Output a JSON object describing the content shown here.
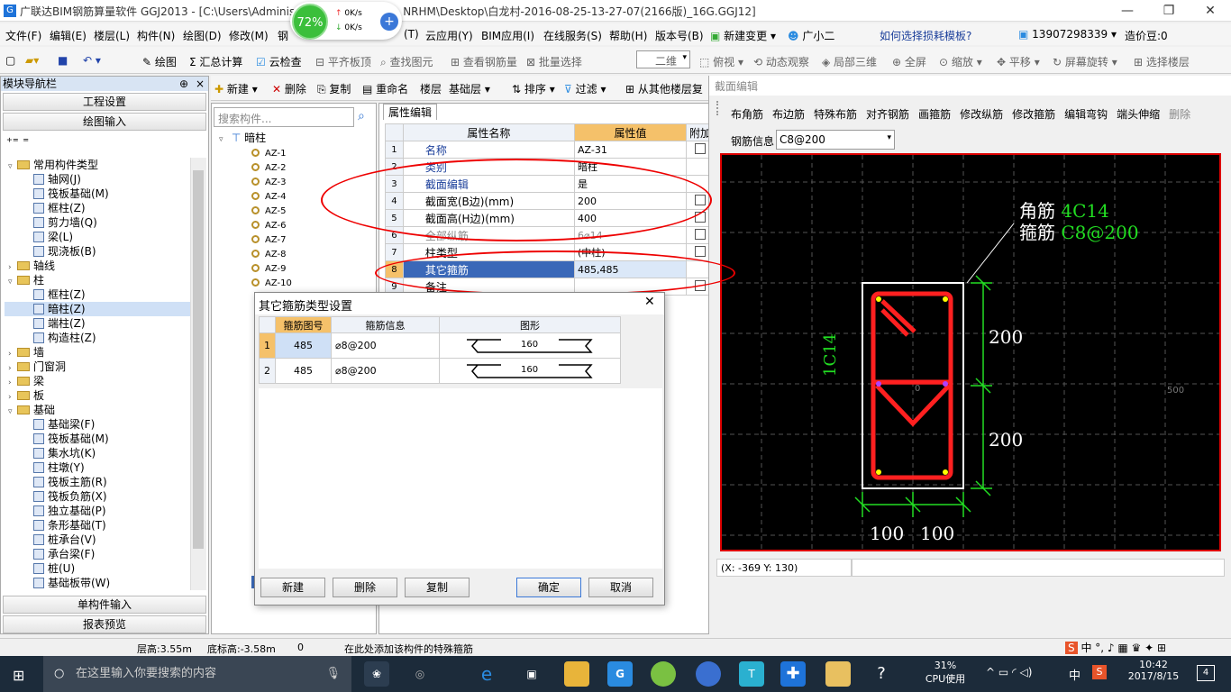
{
  "titlebar": {
    "title": "广联达BIM钢筋算量软件 GGJ2013 - [C:\\Users\\Adminis",
    "title_tail": "NRHM\\Desktop\\白龙村-2016-08-25-13-27-07(2166版)_16G.GGJ12]",
    "min": "—",
    "max": "❐",
    "close": "✕"
  },
  "speed": {
    "percent": "72%",
    "up": "0K/s",
    "down": "0K/s"
  },
  "menu": [
    "文件(F)",
    "编辑(E)",
    "楼层(L)",
    "构件(N)",
    "绘图(D)",
    "修改(M)",
    "钢",
    "(T)",
    "云应用(Y)",
    "BIM应用(I)",
    "在线服务(S)",
    "帮助(H)",
    "版本号(B)"
  ],
  "menu_right": {
    "change": "新建变更",
    "helper": "广小二",
    "tip": "如何选择损耗模板?",
    "phone": "13907298339",
    "coin": "造价豆:0"
  },
  "toolbar": {
    "draw": "绘图",
    "sum": "汇总计算",
    "cloud": "云检查",
    "flat": "平齐板顶",
    "find": "查找图元",
    "view_rebar": "查看钢筋量",
    "batch": "批量选择",
    "view2d": "二维",
    "top": "俯视",
    "dynamic": "动态观察",
    "local3d": "局部三维",
    "full": "全屏",
    "zoom": "缩放",
    "pan": "平移",
    "rotate": "屏幕旋转",
    "select_floor": "选择楼层"
  },
  "nav": {
    "header": "模块导航栏",
    "pin": "⊕",
    "close": "×",
    "proj": "工程设置",
    "draw_input": "绘图输入",
    "single": "单构件输入",
    "report": "报表预览",
    "tree": [
      {
        "t": "常用构件类型",
        "lvl": 0,
        "folder": true,
        "exp": "▿"
      },
      {
        "t": "轴网(J)",
        "lvl": 1
      },
      {
        "t": "筏板基础(M)",
        "lvl": 1
      },
      {
        "t": "框柱(Z)",
        "lvl": 1
      },
      {
        "t": "剪力墙(Q)",
        "lvl": 1
      },
      {
        "t": "梁(L)",
        "lvl": 1
      },
      {
        "t": "现浇板(B)",
        "lvl": 1
      },
      {
        "t": "轴线",
        "lvl": 0,
        "folder": true,
        "exp": "›"
      },
      {
        "t": "柱",
        "lvl": 0,
        "folder": true,
        "exp": "▿"
      },
      {
        "t": "框柱(Z)",
        "lvl": 1
      },
      {
        "t": "暗柱(Z)",
        "lvl": 1,
        "sel": true
      },
      {
        "t": "端柱(Z)",
        "lvl": 1
      },
      {
        "t": "构造柱(Z)",
        "lvl": 1
      },
      {
        "t": "墙",
        "lvl": 0,
        "folder": true,
        "exp": "›"
      },
      {
        "t": "门窗洞",
        "lvl": 0,
        "folder": true,
        "exp": "›"
      },
      {
        "t": "梁",
        "lvl": 0,
        "folder": true,
        "exp": "›"
      },
      {
        "t": "板",
        "lvl": 0,
        "folder": true,
        "exp": "›"
      },
      {
        "t": "基础",
        "lvl": 0,
        "folder": true,
        "exp": "▿"
      },
      {
        "t": "基础梁(F)",
        "lvl": 1
      },
      {
        "t": "筏板基础(M)",
        "lvl": 1
      },
      {
        "t": "集水坑(K)",
        "lvl": 1
      },
      {
        "t": "柱墩(Y)",
        "lvl": 1
      },
      {
        "t": "筏板主筋(R)",
        "lvl": 1
      },
      {
        "t": "筏板负筋(X)",
        "lvl": 1
      },
      {
        "t": "独立基础(P)",
        "lvl": 1
      },
      {
        "t": "条形基础(T)",
        "lvl": 1
      },
      {
        "t": "桩承台(V)",
        "lvl": 1
      },
      {
        "t": "承台梁(F)",
        "lvl": 1
      },
      {
        "t": "桩(U)",
        "lvl": 1
      },
      {
        "t": "基础板带(W)",
        "lvl": 1
      }
    ]
  },
  "mid": {
    "new": "新建",
    "delete": "删除",
    "copy": "复制",
    "rename": "重命名",
    "floor": "楼层",
    "base": "基础层",
    "sort": "排序",
    "filter": "过滤",
    "from_other": "从其他楼层复",
    "search_placeholder": "搜索构件...",
    "root": "暗柱",
    "items": [
      "AZ-1",
      "AZ-2",
      "AZ-3",
      "AZ-4",
      "AZ-5",
      "AZ-6",
      "AZ-7",
      "AZ-8",
      "AZ-9",
      "AZ-10"
    ]
  },
  "prop": {
    "tab": "属性编辑",
    "col_name": "属性名称",
    "col_val": "属性值",
    "col_add": "附加",
    "rows": [
      {
        "n": "1",
        "name": "名称",
        "val": "AZ-31",
        "blue": true
      },
      {
        "n": "2",
        "name": "类别",
        "val": "暗柱",
        "blue": true
      },
      {
        "n": "3",
        "name": "截面编辑",
        "val": "是",
        "blue": true
      },
      {
        "n": "4",
        "name": "截面宽(B边)(mm)",
        "val": "200"
      },
      {
        "n": "5",
        "name": "截面高(H边)(mm)",
        "val": "400"
      },
      {
        "n": "6",
        "name": "全部纵筋",
        "val": "6⌀14",
        "gray": true
      },
      {
        "n": "7",
        "name": "柱类型",
        "val": "(中柱)"
      },
      {
        "n": "8",
        "name": "其它箍筋",
        "val": "485,485",
        "sel": true
      },
      {
        "n": "9",
        "name": "备注",
        "val": ""
      }
    ]
  },
  "dialog": {
    "title": "其它箍筋类型设置",
    "close": "✕",
    "col_no": "箍筋图号",
    "col_info": "箍筋信息",
    "col_shape": "图形",
    "rows": [
      {
        "n": "1",
        "no": "485",
        "info": "⌀8@200",
        "len": "160"
      },
      {
        "n": "2",
        "no": "485",
        "info": "⌀8@200",
        "len": "160"
      }
    ],
    "btn_new": "新建",
    "btn_delete": "删除",
    "btn_copy": "复制",
    "btn_ok": "确定",
    "btn_cancel": "取消"
  },
  "section": {
    "title": "截面编辑",
    "tools": [
      "布角筋",
      "布边筋",
      "特殊布筋",
      "对齐钢筋",
      "画箍筋",
      "修改纵筋",
      "修改箍筋",
      "编辑弯钩",
      "端头伸缩",
      "删除"
    ],
    "rebar_info_label": "钢筋信息",
    "rebar_info_value": "C8@200",
    "corner_label": "角筋",
    "corner_val": "4C14",
    "stirrup_label": "箍筋",
    "stirrup_val": "C8@200",
    "dim_side": "1C14",
    "dim_200a": "200",
    "dim_200b": "200",
    "dim_100a": "100",
    "dim_100b": "100",
    "zero": "0",
    "five": "500",
    "coords": "(X: -369 Y: 130)"
  },
  "status": {
    "floor_h": "层高:3.55m",
    "base_h": "底标高:-3.58m",
    "zero": "0",
    "hint": "在此处添加该构件的特殊箍筋",
    "ime": "中"
  },
  "taskbar": {
    "search": "在这里输入你要搜索的内容",
    "cpu": "31%",
    "cpu_label": "CPU使用",
    "time": "10:42",
    "date": "2017/8/15",
    "lang": "中",
    "notif": "4"
  },
  "colors": {
    "accent": "#1e73d9",
    "rebar_red": "#ff2020",
    "dim_green": "#22dd22",
    "ellipse": "#e00000"
  }
}
